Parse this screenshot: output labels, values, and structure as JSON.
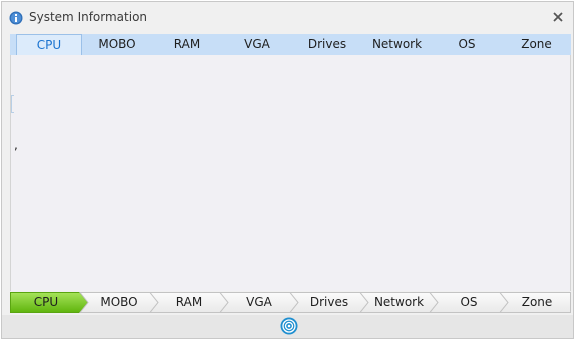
{
  "window": {
    "title": "System Information",
    "close_glyph": "✕",
    "accent_color": "#1a73d0",
    "tab_bar_color": "#c7def7",
    "breadcrumb_active_color": "#74c614"
  },
  "top_tabs": [
    {
      "label": "CPU",
      "active": true
    },
    {
      "label": "MOBO",
      "active": false
    },
    {
      "label": "RAM",
      "active": false
    },
    {
      "label": "VGA",
      "active": false
    },
    {
      "label": "Drives",
      "active": false
    },
    {
      "label": "Network",
      "active": false
    },
    {
      "label": "OS",
      "active": false
    },
    {
      "label": "Zone",
      "active": false
    }
  ],
  "content": {
    "stray_text": ","
  },
  "breadcrumb_tabs": [
    {
      "label": "CPU",
      "active": true
    },
    {
      "label": "MOBO",
      "active": false
    },
    {
      "label": "RAM",
      "active": false
    },
    {
      "label": "VGA",
      "active": false
    },
    {
      "label": "Drives",
      "active": false
    },
    {
      "label": "Network",
      "active": false
    },
    {
      "label": "OS",
      "active": false
    },
    {
      "label": "Zone",
      "active": false
    }
  ],
  "status": {
    "button_icon": "target-icon"
  }
}
